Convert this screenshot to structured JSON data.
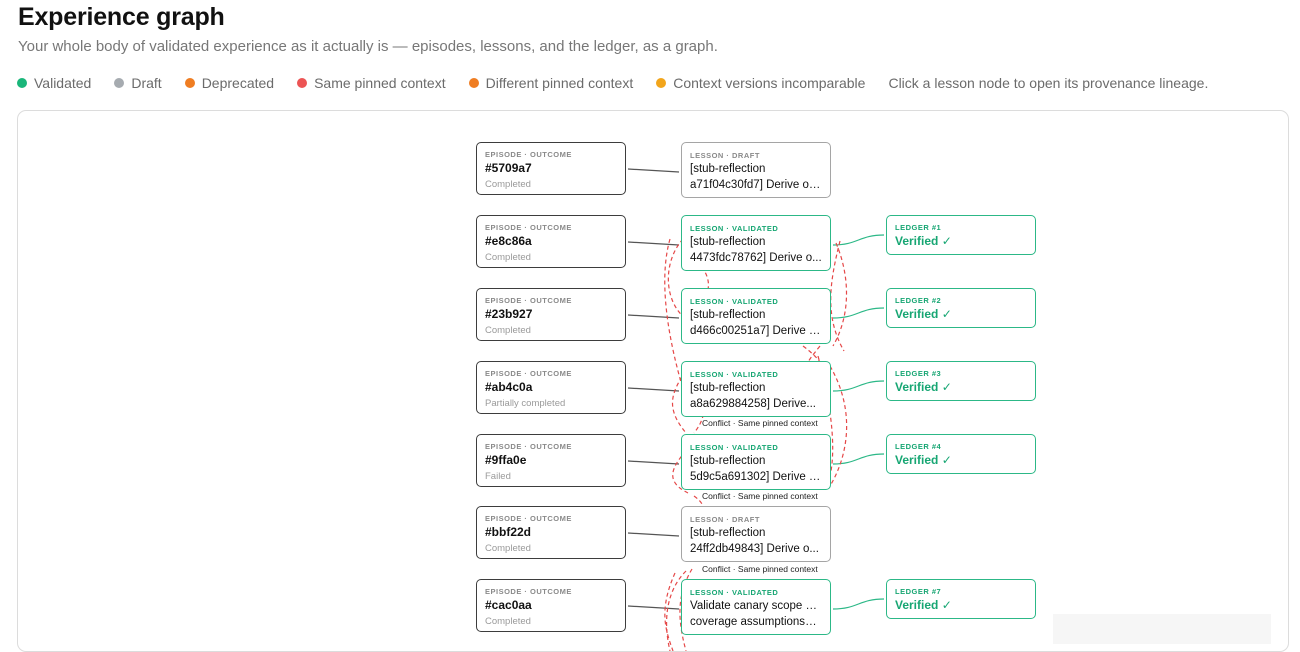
{
  "page": {
    "title": "Experience graph",
    "subtitle": "Your whole body of validated experience as it actually is — episodes, lessons, and the ledger, as a graph.",
    "hint": "Click a lesson node to open its provenance lineage."
  },
  "legend": [
    {
      "label": "Validated",
      "color": "#1ab67a"
    },
    {
      "label": "Draft",
      "color": "#a6abb0"
    },
    {
      "label": "Deprecated",
      "color": "#ef7d22"
    },
    {
      "label": "Same pinned context",
      "color": "#ec5454"
    },
    {
      "label": "Different pinned context",
      "color": "#ef7d22"
    },
    {
      "label": "Context versions incomparable",
      "color": "#f2a51b"
    }
  ],
  "colors": {
    "validated": "#2cb887",
    "draft": "#a5a5a5",
    "episode_border": "#3d3d3d",
    "edge": "#555555",
    "ledger_edge": "#2cb887",
    "conflict_same_context": "#e54848"
  },
  "episodes": [
    {
      "kind": "EPISODE · OUTCOME",
      "id": "#5709a7",
      "outcome": "Completed"
    },
    {
      "kind": "EPISODE · OUTCOME",
      "id": "#e8c86a",
      "outcome": "Completed"
    },
    {
      "kind": "EPISODE · OUTCOME",
      "id": "#23b927",
      "outcome": "Completed"
    },
    {
      "kind": "EPISODE · OUTCOME",
      "id": "#ab4c0a",
      "outcome": "Partially completed"
    },
    {
      "kind": "EPISODE · OUTCOME",
      "id": "#9ffa0e",
      "outcome": "Failed"
    },
    {
      "kind": "EPISODE · OUTCOME",
      "id": "#bbf22d",
      "outcome": "Completed"
    },
    {
      "kind": "EPISODE · OUTCOME",
      "id": "#cac0aa",
      "outcome": "Completed"
    }
  ],
  "lessons": [
    {
      "kind": "LESSON · DRAFT",
      "status": "draft",
      "line1": "[stub-reflection",
      "line2": "a71f04c30fd7] Derive on..."
    },
    {
      "kind": "LESSON · VALIDATED",
      "status": "validated",
      "line1": "[stub-reflection",
      "line2": "4473fdc78762] Derive o..."
    },
    {
      "kind": "LESSON · VALIDATED",
      "status": "validated",
      "line1": "[stub-reflection",
      "line2": "d466c00251a7] Derive o..."
    },
    {
      "kind": "LESSON · VALIDATED",
      "status": "validated",
      "line1": "[stub-reflection",
      "line2": "a8a629884258] Derive..."
    },
    {
      "kind": "LESSON · VALIDATED",
      "status": "validated",
      "line1": "[stub-reflection",
      "line2": "5d9c5a691302] Derive o..."
    },
    {
      "kind": "LESSON · DRAFT",
      "status": "draft",
      "line1": "[stub-reflection",
      "line2": "24ff2db49843] Derive o..."
    },
    {
      "kind": "LESSON · VALIDATED",
      "status": "validated",
      "line1": "Validate canary scope and",
      "line2": "coverage assumptions—..."
    }
  ],
  "ledger": [
    {
      "kind": "LEDGER #1",
      "status": "Verified ✓"
    },
    {
      "kind": "LEDGER #2",
      "status": "Verified ✓"
    },
    {
      "kind": "LEDGER #3",
      "status": "Verified ✓"
    },
    {
      "kind": "LEDGER #4",
      "status": "Verified ✓"
    },
    {
      "kind": "LEDGER #7",
      "status": "Verified ✓"
    }
  ],
  "conflict_labels": [
    "Conflict · Same pinned context",
    "Conflict · Same pinned context",
    "Conflict · Same pinned context"
  ]
}
